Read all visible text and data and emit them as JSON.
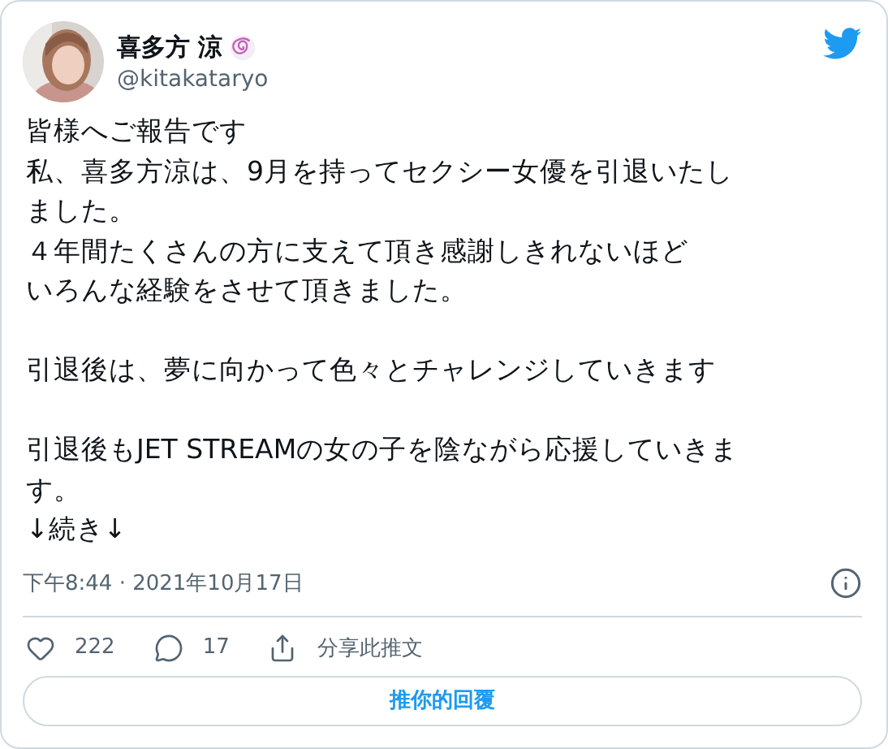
{
  "author": {
    "name": "喜多方 涼",
    "handle": "@kitakataryo"
  },
  "paragraphs": [
    [
      "皆様へご報告です",
      "私、喜多方涼は、9月を持ってセクシー女優を引退いたし",
      "ました。",
      "４年間たくさんの方に支えて頂き感謝しきれないほど",
      "いろんな経験をさせて頂きました。"
    ],
    [
      "引退後は、夢に向かって色々とチャレンジしていきます"
    ],
    [
      "引退後もJET STREAMの女の子を陰ながら応援していきま",
      "す。",
      "↓続き↓"
    ]
  ],
  "timestamp": "下午8:44 · 2021年10月17日",
  "actions": [
    {
      "kind": "like",
      "label": "222"
    },
    {
      "kind": "reply",
      "label": "17"
    },
    {
      "kind": "share",
      "label": "分享此推文"
    }
  ],
  "reply_button": "推你的回覆"
}
